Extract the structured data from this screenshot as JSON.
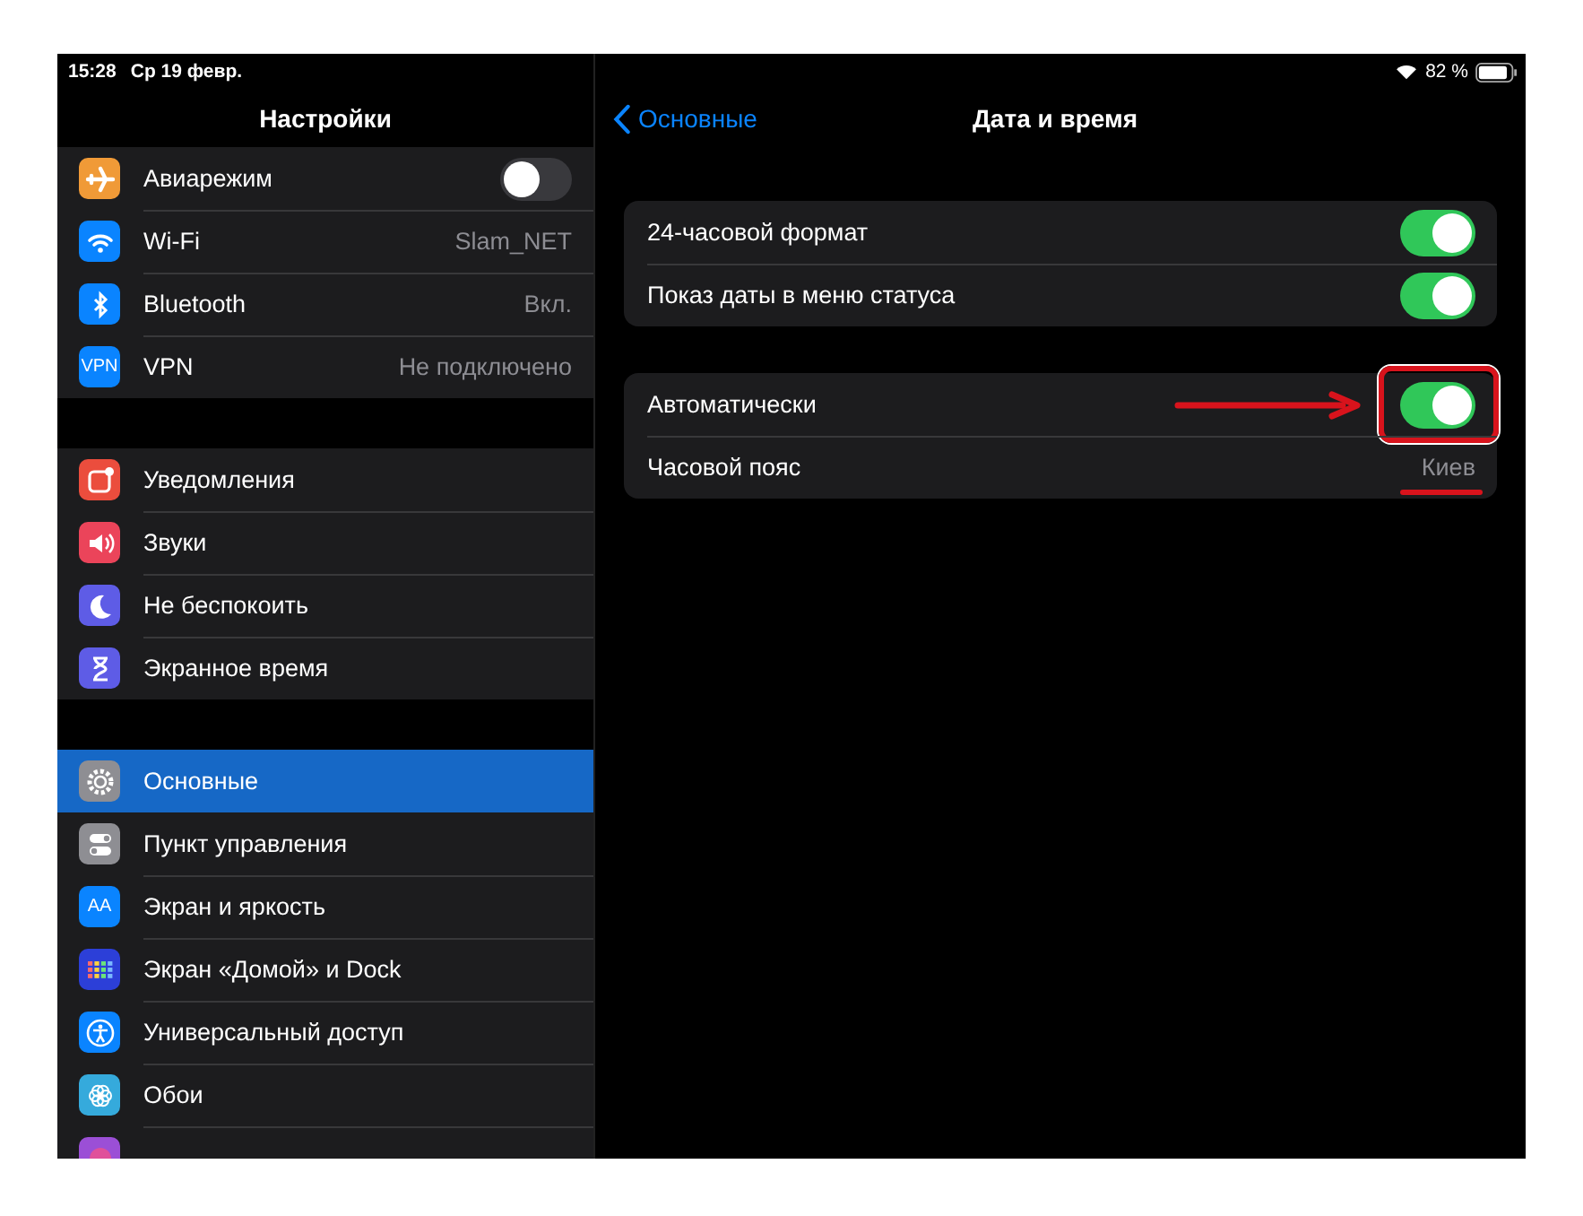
{
  "status_bar": {
    "time": "15:28",
    "date": "Ср 19 февр.",
    "battery": "82 %"
  },
  "sidebar": {
    "title": "Настройки",
    "groups": [
      {
        "items": [
          {
            "kind": "toggle",
            "label": "Авиарежим",
            "on": false,
            "color": "#f09a37",
            "selected": false
          },
          {
            "kind": "value",
            "label": "Wi-Fi",
            "value": "Slam_NET",
            "color": "#0a84ff",
            "selected": false
          },
          {
            "kind": "value",
            "label": "Bluetooth",
            "value": "Вкл.",
            "color": "#0a84ff",
            "selected": false
          },
          {
            "kind": "value",
            "label": "VPN",
            "value": "Не подключено",
            "color": "#0a84ff",
            "icon_text": "VPN",
            "selected": false
          }
        ]
      },
      {
        "items": [
          {
            "kind": "plain",
            "label": "Уведомления",
            "color": "#eb4d3d",
            "selected": false
          },
          {
            "kind": "plain",
            "label": "Звуки",
            "color": "#eb445a",
            "selected": false
          },
          {
            "kind": "plain",
            "label": "Не беспокоить",
            "color": "#5e5ce6",
            "selected": false
          },
          {
            "kind": "plain",
            "label": "Экранное время",
            "color": "#5e5ce6",
            "selected": false
          }
        ]
      },
      {
        "items": [
          {
            "kind": "plain",
            "label": "Основные",
            "color": "#8e8e93",
            "selected": true
          },
          {
            "kind": "plain",
            "label": "Пункт управления",
            "color": "#8e8e93",
            "selected": false
          },
          {
            "kind": "plain",
            "label": "Экран и яркость",
            "color": "#0a84ff",
            "icon_text": "AA",
            "selected": false
          },
          {
            "kind": "plain",
            "label": "Экран «Домой» и Dock",
            "color": "#2c3fd8",
            "selected": false
          },
          {
            "kind": "plain",
            "label": "Универсальный доступ",
            "color": "#0a84ff",
            "selected": false
          },
          {
            "kind": "plain",
            "label": "Обои",
            "color": "#35aadc",
            "selected": false
          },
          {
            "kind": "plain",
            "color": "#9b4fd6",
            "selected": false
          }
        ]
      }
    ]
  },
  "detail": {
    "back": "Основные",
    "title": "Дата и время",
    "groups": [
      {
        "rows": [
          {
            "kind": "toggle",
            "label": "24-часовой формат",
            "on": true
          },
          {
            "kind": "toggle",
            "label": "Показ даты в меню статуса",
            "on": true
          }
        ]
      },
      {
        "rows": [
          {
            "kind": "toggle",
            "label": "Автоматически",
            "on": true,
            "highlighted": true
          },
          {
            "kind": "value",
            "label": "Часовой пояс",
            "value": "Киев",
            "underlined": true
          }
        ]
      }
    ]
  }
}
